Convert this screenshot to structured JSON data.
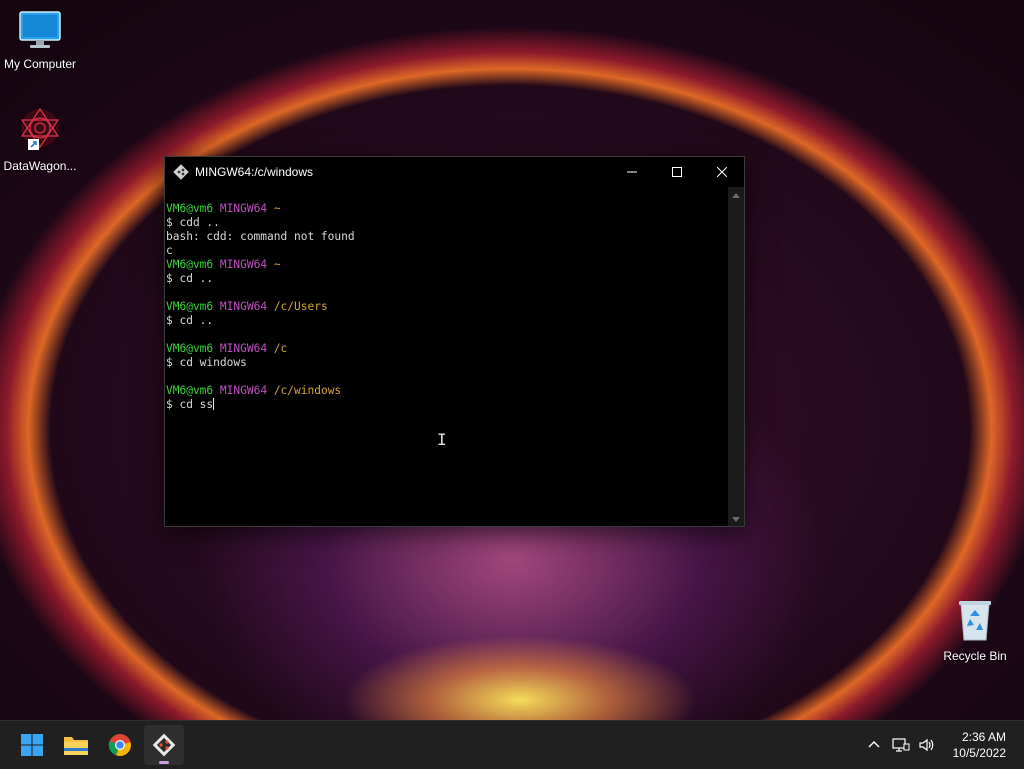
{
  "desktop": {
    "icons": [
      {
        "label": "My Computer",
        "icon": "monitor-icon"
      },
      {
        "label": "DataWagon...",
        "icon": "datawagon-shortcut-icon"
      },
      {
        "label": "Recycle Bin",
        "icon": "recycle-bin-icon"
      }
    ]
  },
  "window": {
    "title": "MINGW64:/c/windows",
    "buttons": {
      "minimize": "minimize-icon",
      "maximize": "maximize-icon",
      "close": "close-icon"
    }
  },
  "terminal": {
    "lines": [
      {
        "user": "VM6@vm6",
        "host": "MINGW64",
        "path": "~"
      },
      {
        "text": "$ cdd .."
      },
      {
        "text": "bash: cdd: command not found"
      },
      {
        "text": "c"
      },
      {
        "user": "VM6@vm6",
        "host": "MINGW64",
        "path": "~"
      },
      {
        "text": "$ cd .."
      },
      {
        "text": ""
      },
      {
        "user": "VM6@vm6",
        "host": "MINGW64",
        "path": "/c/Users"
      },
      {
        "text": "$ cd .."
      },
      {
        "text": ""
      },
      {
        "user": "VM6@vm6",
        "host": "MINGW64",
        "path": "/c"
      },
      {
        "text": "$ cd windows"
      },
      {
        "text": ""
      },
      {
        "user": "VM6@vm6",
        "host": "MINGW64",
        "path": "/c/windows"
      },
      {
        "text": "$ cd ss",
        "cursor": true
      }
    ],
    "colors": {
      "user": "#3bd23b",
      "host": "#c050c0",
      "path": "#d6a53a",
      "text": "#d8d8d8"
    }
  },
  "taskbar": {
    "apps": [
      "start-icon",
      "file-explorer-icon",
      "chrome-icon",
      "git-bash-icon"
    ],
    "active_app": "git-bash-icon",
    "tray": [
      "chevron-up-icon",
      "network-icon",
      "volume-icon"
    ],
    "time": "2:36 AM",
    "date": "10/5/2022"
  }
}
